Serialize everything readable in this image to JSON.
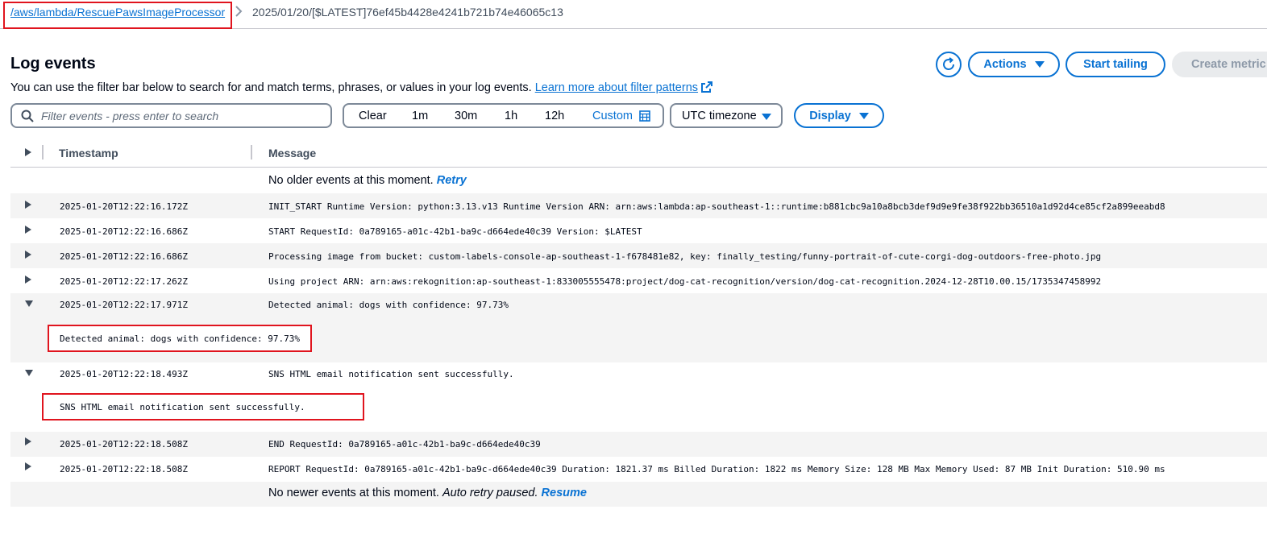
{
  "breadcrumb": {
    "log_group": "/aws/lambda/RescuePawsImageProcessor",
    "log_stream": "2025/01/20/[$LATEST]76ef45b4428e4241b721b74e46065c13"
  },
  "header": {
    "title": "Log events",
    "description": "You can use the filter bar below to search for and match terms, phrases, or values in your log events.",
    "learn_more": "Learn more about filter patterns",
    "actions_label": "Actions",
    "start_tailing_label": "Start tailing",
    "create_metric_label": "Create metric"
  },
  "filter": {
    "search_placeholder": "Filter events - press enter to search",
    "clear": "Clear",
    "ranges": [
      "1m",
      "30m",
      "1h",
      "12h"
    ],
    "custom": "Custom",
    "timezone": "UTC timezone",
    "display": "Display"
  },
  "table": {
    "col_timestamp": "Timestamp",
    "col_message": "Message",
    "top_notice": "No older events at this moment.",
    "retry": "Retry",
    "bottom_notice": "No newer events at this moment.",
    "auto_retry": "Auto retry paused.",
    "resume": "Resume",
    "rows": [
      {
        "ts": "2025-01-20T12:22:16.172Z",
        "msg": "INIT_START Runtime Version: python:3.13.v13 Runtime Version ARN: arn:aws:lambda:ap-southeast-1::runtime:b881cbc9a10a8bcb3def9d9e9fe38f922bb36510a1d92d4ce85cf2a899eeabd8"
      },
      {
        "ts": "2025-01-20T12:22:16.686Z",
        "msg": "START RequestId: 0a789165-a01c-42b1-ba9c-d664ede40c39 Version: $LATEST"
      },
      {
        "ts": "2025-01-20T12:22:16.686Z",
        "msg": "Processing image from bucket: custom-labels-console-ap-southeast-1-f678481e82, key: finally_testing/funny-portrait-of-cute-corgi-dog-outdoors-free-photo.jpg"
      },
      {
        "ts": "2025-01-20T12:22:17.262Z",
        "msg": "Using project ARN: arn:aws:rekognition:ap-southeast-1:833005555478:project/dog-cat-recognition/version/dog-cat-recognition.2024-12-28T10.00.15/1735347458992"
      },
      {
        "ts": "2025-01-20T12:22:17.971Z",
        "msg": "Detected animal: dogs with confidence: 97.73%",
        "detail": "Detected animal: dogs with confidence: 97.73%"
      },
      {
        "ts": "2025-01-20T12:22:18.493Z",
        "msg": "SNS HTML email notification sent successfully.",
        "detail": "SNS HTML email notification sent successfully."
      },
      {
        "ts": "2025-01-20T12:22:18.508Z",
        "msg": "END RequestId: 0a789165-a01c-42b1-ba9c-d664ede40c39"
      },
      {
        "ts": "2025-01-20T12:22:18.508Z",
        "msg": "REPORT RequestId: 0a789165-a01c-42b1-ba9c-d664ede40c39 Duration: 1821.37 ms Billed Duration: 1822 ms Memory Size: 128 MB Max Memory Used: 87 MB Init Duration: 510.90 ms"
      }
    ]
  },
  "colors": {
    "accent": "#0972d3",
    "highlight": "#e0141e"
  }
}
